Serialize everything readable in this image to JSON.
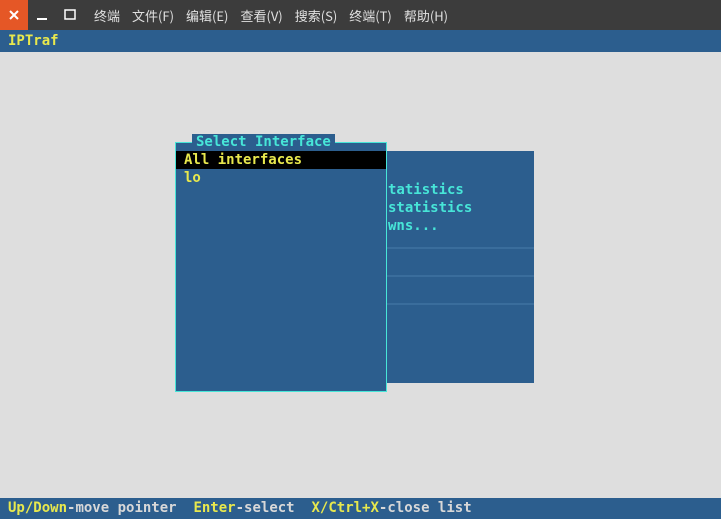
{
  "titlebar": {
    "menu": [
      "终端",
      "文件(F)",
      "编辑(E)",
      "查看(V)",
      "搜索(S)",
      "终端(T)",
      "帮助(H)"
    ]
  },
  "app_title": "IPTraf",
  "select_panel": {
    "title": "Select Interface",
    "items": [
      "All interfaces",
      "lo"
    ],
    "selected_index": 0
  },
  "right_panel": {
    "lines": [
      "tatistics",
      "statistics",
      "wns..."
    ]
  },
  "status": {
    "k1": "Up/Down",
    "d1": "-move pointer",
    "k2": "Enter",
    "d2": "-select",
    "k3": "X/Ctrl+X",
    "d3": "-close list"
  }
}
